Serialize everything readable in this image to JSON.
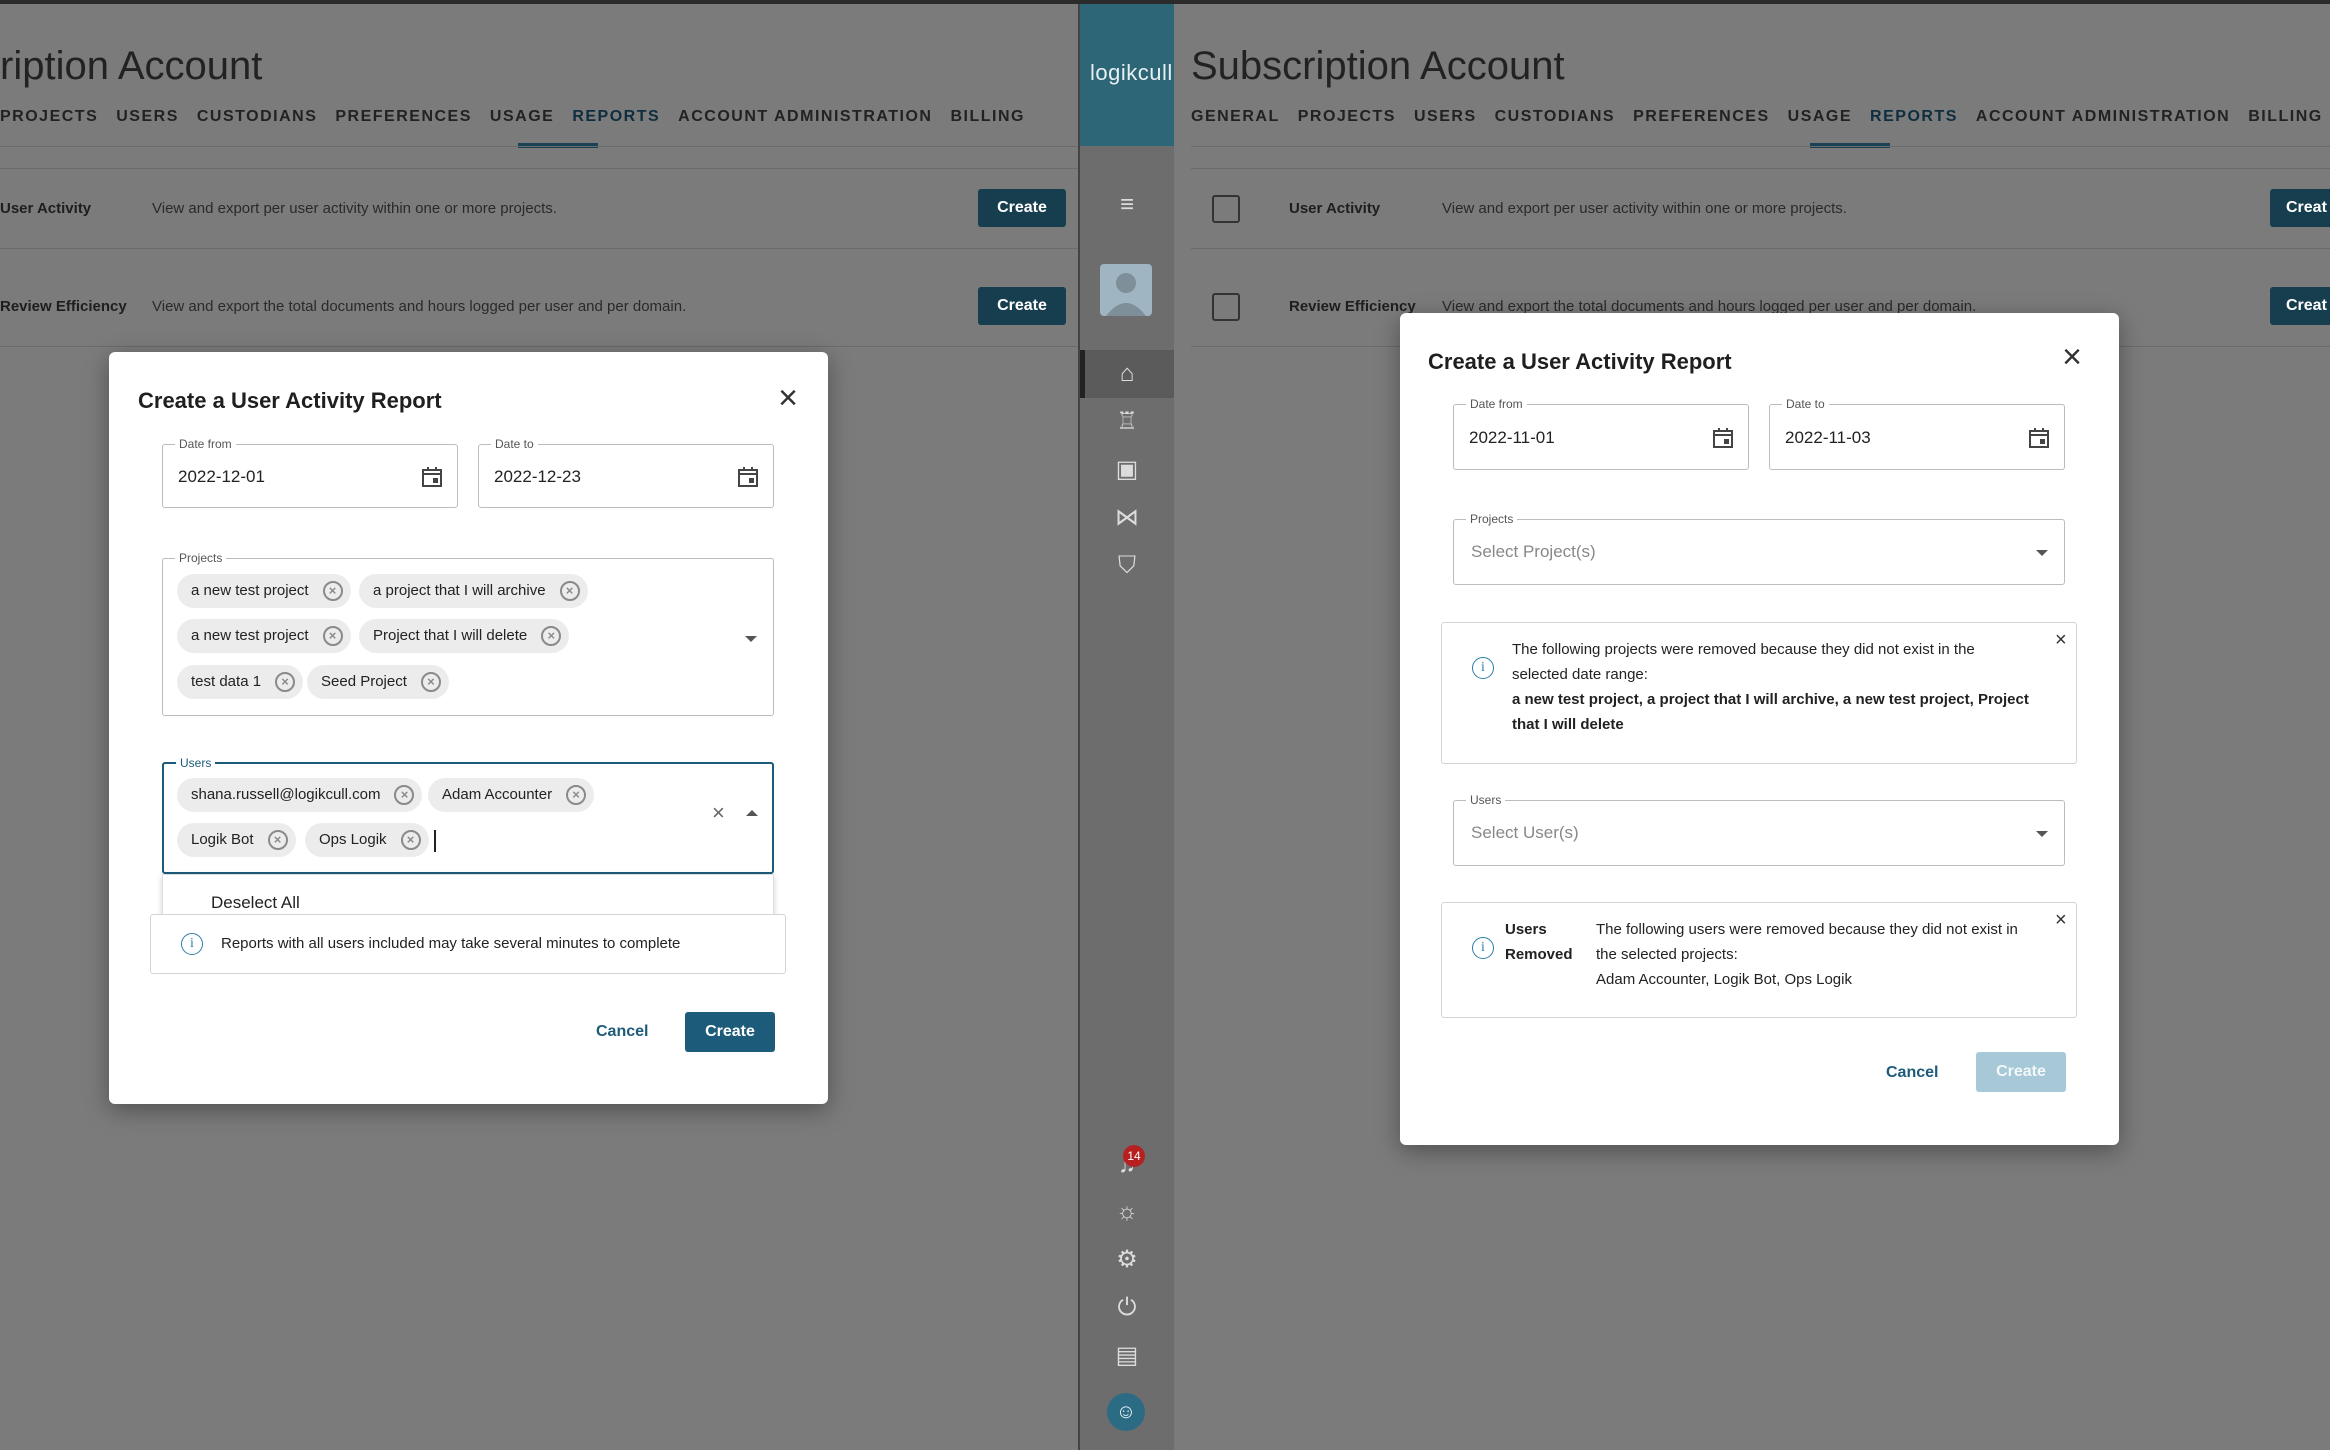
{
  "left": {
    "page_title": "ription Account",
    "tabs": [
      "PROJECTS",
      "USERS",
      "CUSTODIANS",
      "PREFERENCES",
      "USAGE",
      "REPORTS",
      "ACCOUNT ADMINISTRATION",
      "BILLING"
    ],
    "reports": [
      {
        "name": "User Activity",
        "desc": "View and export per user activity within one or more projects.",
        "button": "Create"
      },
      {
        "name": "Review Efficiency",
        "desc": "View and export the total documents and hours logged per user and per domain.",
        "button": "Create"
      }
    ],
    "modal": {
      "title": "Create a User Activity Report",
      "date_from_label": "Date from",
      "date_from": "2022-12-01",
      "date_to_label": "Date to",
      "date_to": "2022-12-23",
      "projects_label": "Projects",
      "projects": [
        "a new test project",
        "a project that I will archive",
        "a new test project",
        "Project that I will delete",
        "test data 1",
        "Seed Project"
      ],
      "users_label": "Users",
      "users": [
        "shana.russell@logikcull.com",
        "Adam Accounter",
        "Logik Bot",
        "Ops Logik"
      ],
      "dropdown_option": "Deselect All",
      "info_text": "Reports with all users included may take several minutes to complete",
      "cancel": "Cancel",
      "create": "Create"
    }
  },
  "sidebar": {
    "logo": "logikcull",
    "badge_count": "14"
  },
  "right": {
    "page_title": "Subscription Account",
    "tabs": [
      "GENERAL",
      "PROJECTS",
      "USERS",
      "CUSTODIANS",
      "PREFERENCES",
      "USAGE",
      "REPORTS",
      "ACCOUNT ADMINISTRATION",
      "BILLING"
    ],
    "reports": [
      {
        "name": "User Activity",
        "desc": "View and export per user activity within one or more projects.",
        "button": "Creat"
      },
      {
        "name": "Review Efficiency",
        "desc": "View and export the total documents and hours logged per user and per domain.",
        "button": "Creat"
      }
    ],
    "modal": {
      "title": "Create a User Activity Report",
      "date_from_label": "Date from",
      "date_from": "2022-11-01",
      "date_to_label": "Date to",
      "date_to": "2022-11-03",
      "projects_label": "Projects",
      "projects_placeholder": "Select Project(s)",
      "projects_notice_line1": "The following projects were removed because they did not exist in the",
      "projects_notice_line2": "selected date range:",
      "projects_notice_list1": "a new test project, a project that I will archive, a new test project, Project",
      "projects_notice_list2": "that I will delete",
      "users_label": "Users",
      "users_placeholder": "Select User(s)",
      "users_notice_heading1": "Users",
      "users_notice_heading2": "Removed",
      "users_notice_line1": "The following users were removed because they did not exist in",
      "users_notice_line2": "the selected projects:",
      "users_notice_list": "Adam Accounter, Logik Bot, Ops Logik",
      "cancel": "Cancel",
      "create": "Create"
    }
  },
  "colors": {
    "brand": "#2d6676",
    "primary_button": "#1c5b7a",
    "disabled_button": "#a6c8d7",
    "info": "#2a7ea3",
    "badge": "#b62020"
  }
}
